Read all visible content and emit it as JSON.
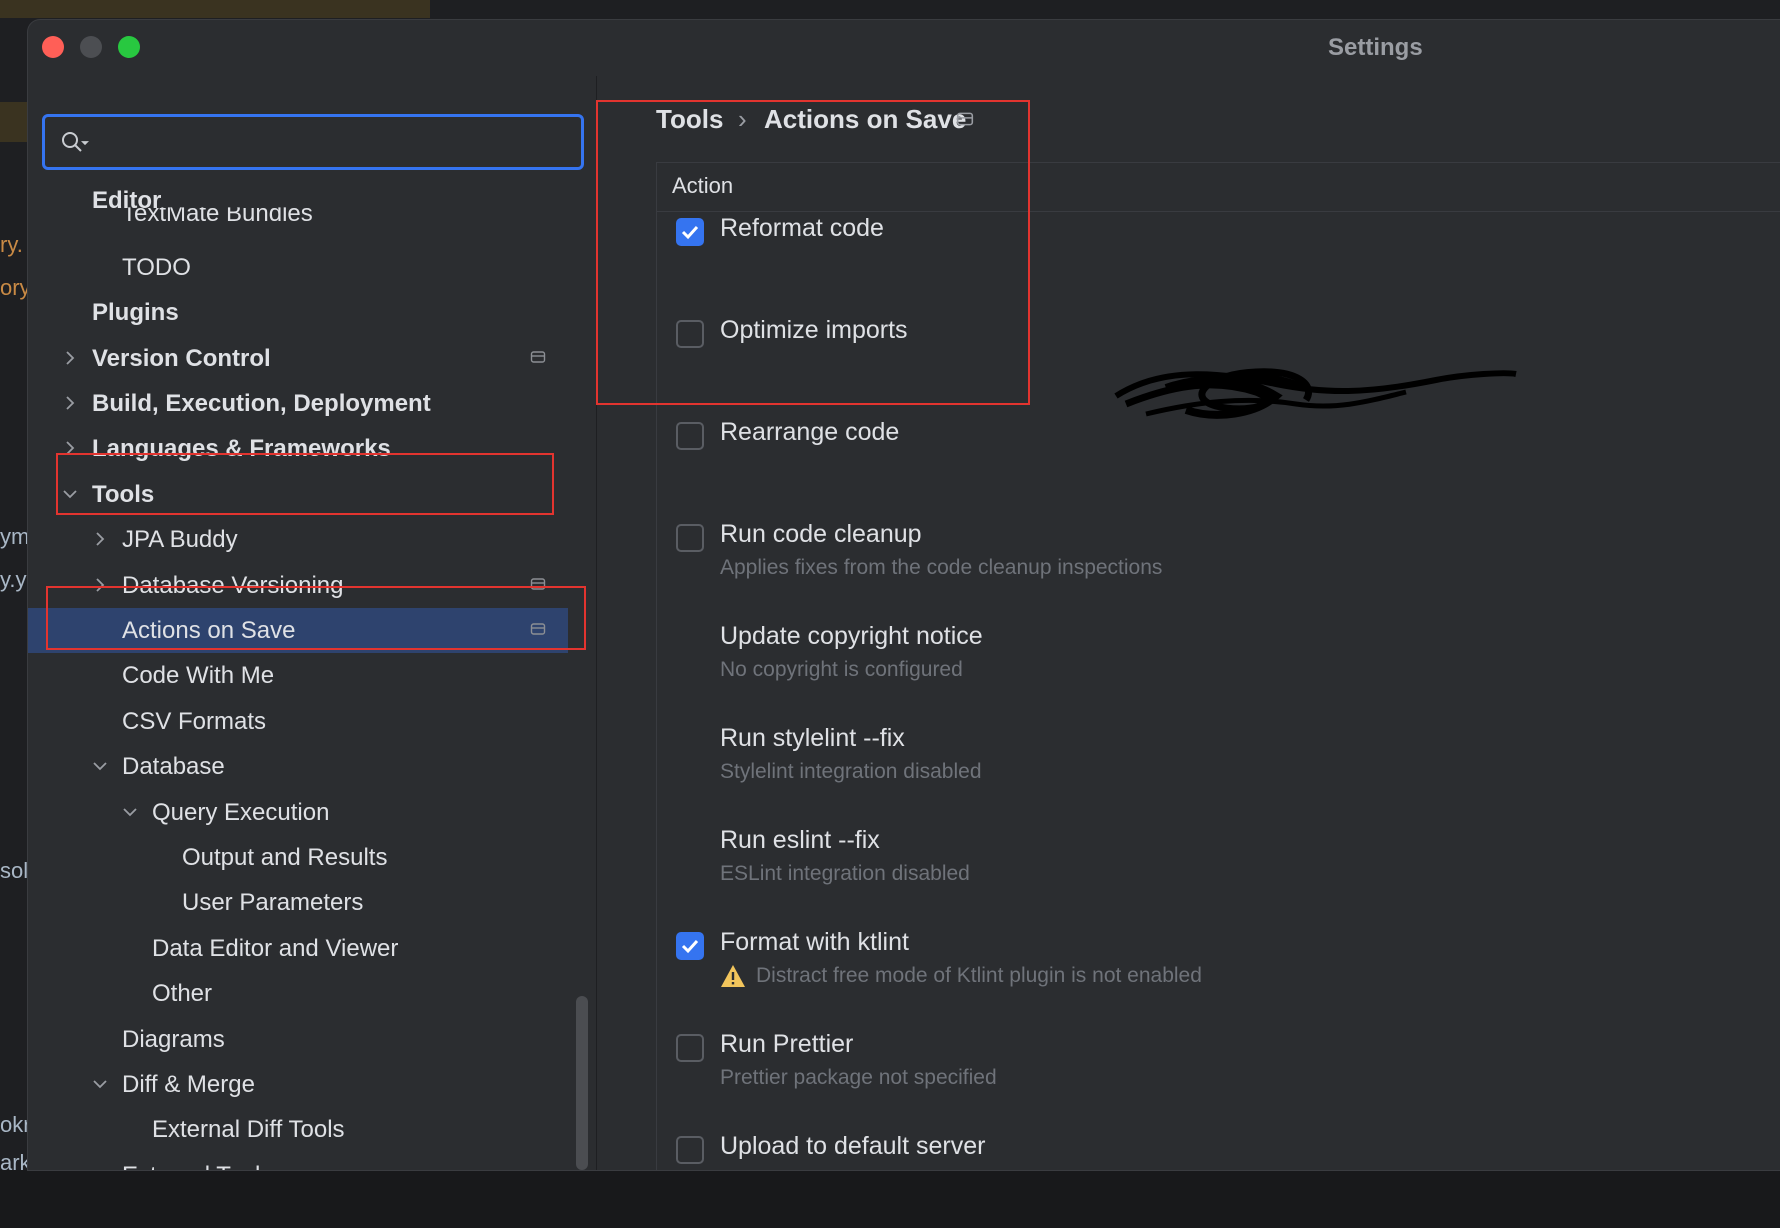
{
  "window": {
    "title": "Settings"
  },
  "search": {
    "placeholder": "",
    "value": ""
  },
  "tree": [
    {
      "label": "Editor",
      "level": 0,
      "bold": true,
      "chevron": "",
      "gear": false,
      "selected": false
    },
    {
      "label": "TextMate Bundles",
      "level": 1,
      "bold": false,
      "chevron": "",
      "gear": false,
      "selected": false
    },
    {
      "label": "TODO",
      "level": 1,
      "bold": false,
      "chevron": "",
      "gear": false,
      "selected": false
    },
    {
      "label": "Plugins",
      "level": 0,
      "bold": true,
      "chevron": "",
      "gear": false,
      "selected": false
    },
    {
      "label": "Version Control",
      "level": 0,
      "bold": true,
      "chevron": "right",
      "gear": true,
      "selected": false
    },
    {
      "label": "Build, Execution, Deployment",
      "level": 0,
      "bold": true,
      "chevron": "right",
      "gear": false,
      "selected": false
    },
    {
      "label": "Languages & Frameworks",
      "level": 0,
      "bold": true,
      "chevron": "right",
      "gear": false,
      "selected": false
    },
    {
      "label": "Tools",
      "level": 0,
      "bold": true,
      "chevron": "down",
      "gear": false,
      "selected": false
    },
    {
      "label": "JPA Buddy",
      "level": 1,
      "bold": false,
      "chevron": "right",
      "gear": false,
      "selected": false
    },
    {
      "label": "Database Versioning",
      "level": 1,
      "bold": false,
      "chevron": "right",
      "gear": true,
      "selected": false
    },
    {
      "label": "Actions on Save",
      "level": 1,
      "bold": false,
      "chevron": "",
      "gear": true,
      "selected": true
    },
    {
      "label": "Code With Me",
      "level": 1,
      "bold": false,
      "chevron": "",
      "gear": false,
      "selected": false
    },
    {
      "label": "CSV Formats",
      "level": 1,
      "bold": false,
      "chevron": "",
      "gear": false,
      "selected": false
    },
    {
      "label": "Database",
      "level": 1,
      "bold": false,
      "chevron": "down",
      "gear": false,
      "selected": false
    },
    {
      "label": "Query Execution",
      "level": 2,
      "bold": false,
      "chevron": "down",
      "gear": false,
      "selected": false
    },
    {
      "label": "Output and Results",
      "level": 3,
      "bold": false,
      "chevron": "",
      "gear": false,
      "selected": false
    },
    {
      "label": "User Parameters",
      "level": 3,
      "bold": false,
      "chevron": "",
      "gear": false,
      "selected": false
    },
    {
      "label": "Data Editor and Viewer",
      "level": 2,
      "bold": false,
      "chevron": "",
      "gear": false,
      "selected": false
    },
    {
      "label": "Other",
      "level": 2,
      "bold": false,
      "chevron": "",
      "gear": false,
      "selected": false
    },
    {
      "label": "Diagrams",
      "level": 1,
      "bold": false,
      "chevron": "",
      "gear": false,
      "selected": false
    },
    {
      "label": "Diff & Merge",
      "level": 1,
      "bold": false,
      "chevron": "down",
      "gear": false,
      "selected": false
    },
    {
      "label": "External Diff Tools",
      "level": 2,
      "bold": false,
      "chevron": "",
      "gear": false,
      "selected": false
    },
    {
      "label": "External Tools",
      "level": 1,
      "bold": false,
      "chevron": "",
      "gear": false,
      "selected": false
    }
  ],
  "breadcrumb": {
    "parent": "Tools",
    "separator": "›",
    "current": "Actions on Save"
  },
  "table": {
    "header": "Action"
  },
  "actions": [
    {
      "title": "Reformat code",
      "subtitle": "",
      "checked": true,
      "warning": false
    },
    {
      "title": "Optimize imports",
      "subtitle": "",
      "checked": false,
      "warning": false,
      "obscured": true
    },
    {
      "title": "Rearrange code",
      "subtitle": "",
      "checked": false,
      "warning": false
    },
    {
      "title": "Run code cleanup",
      "subtitle": "Applies fixes from the code cleanup inspections",
      "checked": false,
      "warning": false
    },
    {
      "title": "Update copyright notice",
      "subtitle": "No copyright is configured",
      "checked": null,
      "warning": false
    },
    {
      "title": "Run stylelint --fix",
      "subtitle": "Stylelint integration disabled",
      "checked": null,
      "warning": false
    },
    {
      "title": "Run eslint --fix",
      "subtitle": "ESLint integration disabled",
      "checked": null,
      "warning": false
    },
    {
      "title": "Format with ktlint",
      "subtitle": "Distract free mode of Ktlint plugin is not enabled",
      "checked": true,
      "warning": true
    },
    {
      "title": "Run Prettier",
      "subtitle": "Prettier package not specified",
      "checked": false,
      "warning": false
    },
    {
      "title": "Upload to default server",
      "subtitle": "",
      "checked": false,
      "warning": false
    }
  ],
  "background": {
    "fragments": [
      "ry.",
      "ory",
      "ym",
      "y.y",
      "sol",
      "okr",
      "ark"
    ]
  },
  "colors": {
    "accent": "#3574f0",
    "selection": "#2e436e",
    "annotation": "#e3342f",
    "warning": "#f2c55c"
  }
}
